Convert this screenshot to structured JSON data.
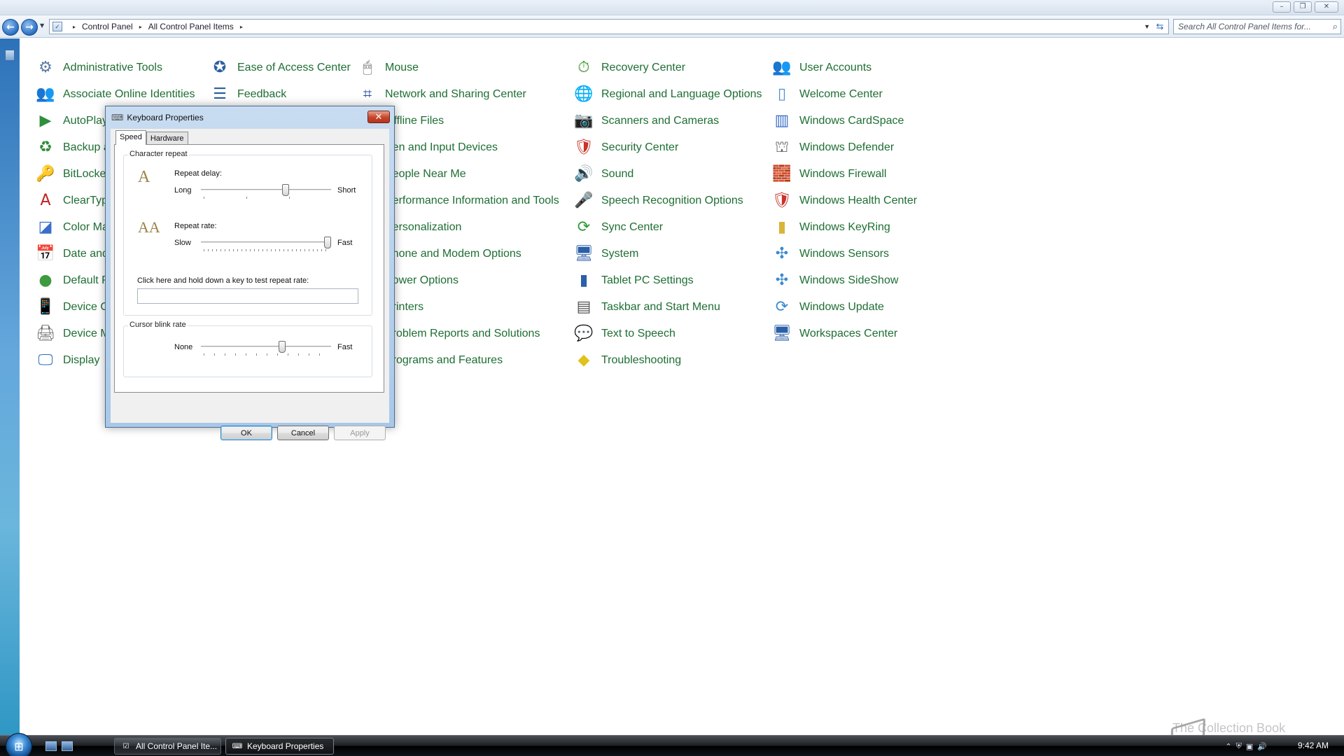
{
  "window": {
    "caption_buttons": {
      "minimize": "–",
      "maximize": "❐",
      "close": "✕"
    }
  },
  "address": {
    "crumbs": [
      "Control Panel",
      "All Control Panel Items"
    ],
    "separator": "▸",
    "search_placeholder": "Search All Control Panel Items for..."
  },
  "control_panel": {
    "link_color": "#1e6e33",
    "columns": [
      [
        {
          "label": "Administrative Tools",
          "icon": "admin-tools-icon",
          "glyph": "⚙",
          "color": "#5a7aa0"
        },
        {
          "label": "Associate Online Identities",
          "icon": "online-identities-icon",
          "glyph": "👥",
          "color": "#4c7f3f"
        },
        {
          "label": "AutoPlay",
          "icon": "autoplay-icon",
          "glyph": "▶",
          "color": "#2f8f3a"
        },
        {
          "label": "Backup and Restore",
          "icon": "backup-icon",
          "glyph": "♻",
          "color": "#2e8b3c"
        },
        {
          "label": "BitLocker Drive Encryption",
          "icon": "bitlocker-icon",
          "glyph": "🔑",
          "color": "#7c7c7c"
        },
        {
          "label": "ClearType Text Tuner",
          "icon": "cleartype-icon",
          "glyph": "A",
          "color": "#c02020"
        },
        {
          "label": "Color Management",
          "icon": "color-management-icon",
          "glyph": "◪",
          "color": "#3a6fc9"
        },
        {
          "label": "Date and Time",
          "icon": "date-time-icon",
          "glyph": "📅",
          "color": "#4a7fb8"
        },
        {
          "label": "Default Programs",
          "icon": "default-programs-icon",
          "glyph": "●",
          "color": "#3d9a3d"
        },
        {
          "label": "Device Center",
          "icon": "device-center-icon",
          "glyph": "📱",
          "color": "#5a5a5a"
        },
        {
          "label": "Device Manager",
          "icon": "device-manager-icon",
          "glyph": "🖨",
          "color": "#6a6a6a"
        },
        {
          "label": "Display",
          "icon": "display-icon",
          "glyph": "🖵",
          "color": "#2b6db8"
        }
      ],
      [
        {
          "label": "Ease of Access Center",
          "icon": "ease-of-access-icon",
          "glyph": "✪",
          "color": "#2c5f9e"
        },
        {
          "label": "Feedback",
          "icon": "feedback-icon",
          "glyph": "☰",
          "color": "#2c5f9e"
        }
      ],
      [
        {
          "label": "Mouse",
          "icon": "mouse-icon",
          "glyph": "🖱",
          "color": "#555555"
        },
        {
          "label": "Network and Sharing Center",
          "icon": "network-sharing-icon",
          "glyph": "⌗",
          "color": "#2a4fa0"
        },
        {
          "label": "Offline Files",
          "icon": "offline-files-icon",
          "glyph": "",
          "color": "#3a8a3a"
        },
        {
          "label": "Pen and Input Devices",
          "icon": "pen-input-icon",
          "glyph": "",
          "color": "#555555"
        },
        {
          "label": "People Near Me",
          "icon": "people-near-me-icon",
          "glyph": "",
          "color": "#555555"
        },
        {
          "label": "Performance Information and Tools",
          "icon": "performance-icon",
          "glyph": "",
          "color": "#555555"
        },
        {
          "label": "Personalization",
          "icon": "personalization-icon",
          "glyph": "",
          "color": "#555555"
        },
        {
          "label": "Phone and Modem Options",
          "icon": "phone-modem-icon",
          "glyph": "",
          "color": "#555555"
        },
        {
          "label": "Power Options",
          "icon": "power-options-icon",
          "glyph": "",
          "color": "#555555"
        },
        {
          "label": "Printers",
          "icon": "printers-icon",
          "glyph": "",
          "color": "#555555"
        },
        {
          "label": "Problem Reports and Solutions",
          "icon": "problem-reports-icon",
          "glyph": "",
          "color": "#555555"
        },
        {
          "label": "Programs and Features",
          "icon": "programs-features-icon",
          "glyph": "",
          "color": "#555555"
        }
      ],
      [
        {
          "label": "Recovery Center",
          "icon": "recovery-center-icon",
          "glyph": "⏱",
          "color": "#3d8f2f"
        },
        {
          "label": "Regional and Language Options",
          "icon": "regional-language-icon",
          "glyph": "🌐",
          "color": "#2a6fb0"
        },
        {
          "label": "Scanners and Cameras",
          "icon": "scanners-cameras-icon",
          "glyph": "📷",
          "color": "#555555"
        },
        {
          "label": "Security Center",
          "icon": "security-center-icon",
          "glyph": "🛡",
          "color": "#c9342a"
        },
        {
          "label": "Sound",
          "icon": "sound-icon",
          "glyph": "🔊",
          "color": "#707070"
        },
        {
          "label": "Speech Recognition Options",
          "icon": "speech-recognition-icon",
          "glyph": "🎤",
          "color": "#555555"
        },
        {
          "label": "Sync Center",
          "icon": "sync-center-icon",
          "glyph": "⟳",
          "color": "#2e9a3a"
        },
        {
          "label": "System",
          "icon": "system-icon",
          "glyph": "🖥",
          "color": "#2b5fa8"
        },
        {
          "label": "Tablet PC Settings",
          "icon": "tablet-pc-icon",
          "glyph": "▮",
          "color": "#2b5fa8"
        },
        {
          "label": "Taskbar and Start Menu",
          "icon": "taskbar-start-icon",
          "glyph": "▤",
          "color": "#555555"
        },
        {
          "label": "Text to Speech",
          "icon": "text-to-speech-icon",
          "glyph": "💬",
          "color": "#c9a020"
        },
        {
          "label": "Troubleshooting",
          "icon": "troubleshooting-icon",
          "glyph": "◆",
          "color": "#e2c21a"
        }
      ],
      [
        {
          "label": "User Accounts",
          "icon": "user-accounts-icon",
          "glyph": "👥",
          "color": "#4c7f3f"
        },
        {
          "label": "Welcome Center",
          "icon": "welcome-center-icon",
          "glyph": "▯",
          "color": "#4a8fd0"
        },
        {
          "label": "Windows CardSpace",
          "icon": "cardspace-icon",
          "glyph": "▥",
          "color": "#3a6fc9"
        },
        {
          "label": "Windows Defender",
          "icon": "defender-icon",
          "glyph": "⛫",
          "color": "#6a6a6a"
        },
        {
          "label": "Windows Firewall",
          "icon": "firewall-icon",
          "glyph": "🧱",
          "color": "#a8442a"
        },
        {
          "label": "Windows Health Center",
          "icon": "health-center-icon",
          "glyph": "🛡",
          "color": "#c9342a"
        },
        {
          "label": "Windows KeyRing",
          "icon": "keyring-icon",
          "glyph": "▮",
          "color": "#d8b43a"
        },
        {
          "label": "Windows Sensors",
          "icon": "sensors-icon",
          "glyph": "✣",
          "color": "#3a8ad0"
        },
        {
          "label": "Windows SideShow",
          "icon": "sideshow-icon",
          "glyph": "✣",
          "color": "#3a8ad0"
        },
        {
          "label": "Windows Update",
          "icon": "windows-update-icon",
          "glyph": "⟳",
          "color": "#3a8ad0"
        },
        {
          "label": "Workspaces Center",
          "icon": "workspaces-icon",
          "glyph": "🖥",
          "color": "#2b5fa8"
        }
      ]
    ]
  },
  "dialog": {
    "title": "Keyboard Properties",
    "close": "✕",
    "tabs": [
      "Speed",
      "Hardware"
    ],
    "character_repeat": {
      "group_label": "Character repeat",
      "repeat_delay_label": "Repeat delay:",
      "repeat_delay_min": "Long",
      "repeat_delay_max": "Short",
      "repeat_delay_value": 0.66,
      "repeat_rate_label": "Repeat rate:",
      "repeat_rate_min": "Slow",
      "repeat_rate_max": "Fast",
      "repeat_rate_value": 1.0,
      "test_label": "Click here and hold down a key to test repeat rate:",
      "test_value": ""
    },
    "cursor_blink": {
      "group_label": "Cursor blink rate",
      "min": "None",
      "max": "Fast",
      "value": 0.63
    },
    "buttons": {
      "ok": "OK",
      "cancel": "Cancel",
      "apply": "Apply"
    }
  },
  "taskbar": {
    "tasks": [
      "All Control Panel Ite...",
      "Keyboard Properties"
    ],
    "clock": "9:42 AM"
  },
  "watermark": "The Collection Book"
}
